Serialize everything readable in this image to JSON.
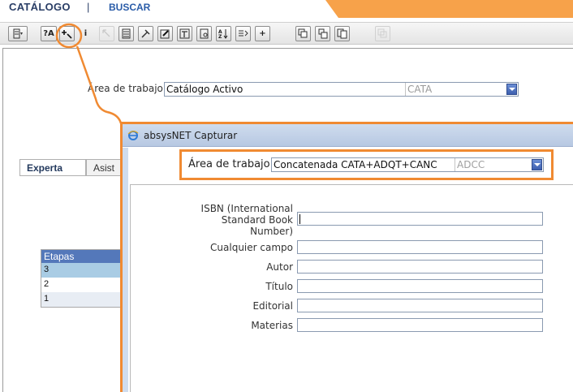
{
  "header": {
    "menu_catalogo": "CATÁLOGO",
    "menu_separator": "|",
    "menu_buscar": "BUSCAR"
  },
  "toolbar": {
    "help_label": "?A",
    "info_label": "i",
    "az_label": "A↓Z",
    "add_label": "+"
  },
  "main": {
    "area_label": "Área de trabajo",
    "area_value": "Catálogo Activo",
    "area_code": "CATA",
    "tabs": [
      {
        "label": "Experta"
      },
      {
        "label": "Asist"
      }
    ],
    "etapas": {
      "header": "Etapas",
      "rows": [
        "3",
        "2",
        "1"
      ]
    }
  },
  "dialog": {
    "title": "absysNET Capturar",
    "area_label": "Área de trabajo",
    "area_value": "Concatenada CATA+ADQT+CANC",
    "area_code": "ADCC",
    "fields": [
      {
        "label": "ISBN (International Standard Book Number)",
        "value": ""
      },
      {
        "label": "Cualquier campo",
        "value": ""
      },
      {
        "label": "Autor",
        "value": ""
      },
      {
        "label": "Título",
        "value": ""
      },
      {
        "label": "Editorial",
        "value": ""
      },
      {
        "label": "Materias",
        "value": ""
      }
    ]
  },
  "colors": {
    "accent_orange": "#f08a32",
    "header_orange": "#f7a24a",
    "nav_blue": "#2a5ca8",
    "table_header_blue": "#5478ba"
  }
}
